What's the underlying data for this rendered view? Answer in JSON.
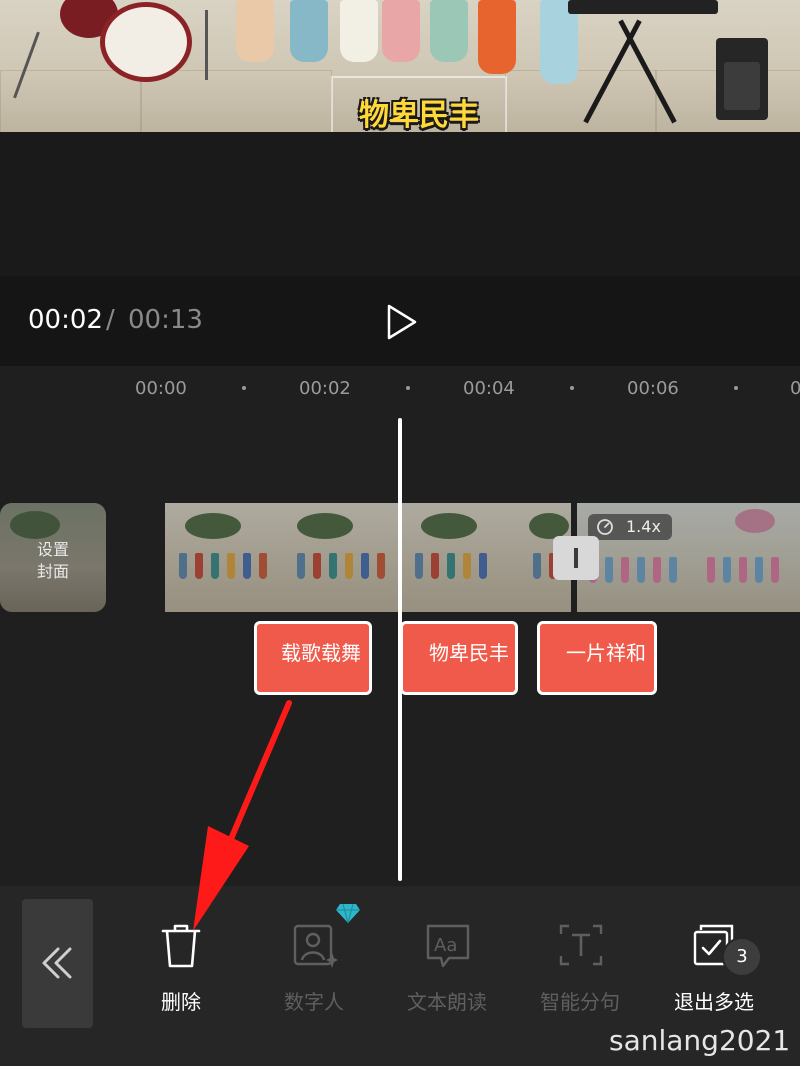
{
  "preview": {
    "subtitle": "物卑民丰"
  },
  "playback": {
    "current_time": "00:02",
    "separator": "/",
    "total_time": "00:13"
  },
  "timeline": {
    "ticks": [
      "00:00",
      "00:02",
      "00:04",
      "00:06",
      "0"
    ],
    "cover_label_line1": "设置",
    "cover_label_line2": "封面",
    "speed": "1.4x",
    "text_clips": [
      "载歌载舞",
      "物卑民丰",
      "一片祥和"
    ]
  },
  "toolbar": {
    "delete_label": "删除",
    "digital_human_label": "数字人",
    "tts_label": "文本朗读",
    "smart_split_label": "智能分句",
    "exit_multiselect_label": "退出多选",
    "selected_count": "3"
  },
  "watermark": "sanlang2021",
  "colors": {
    "accent_red": "#f05a4a",
    "arrow_red": "#ff1a1a",
    "subtitle_yellow": "#ffd93a"
  }
}
